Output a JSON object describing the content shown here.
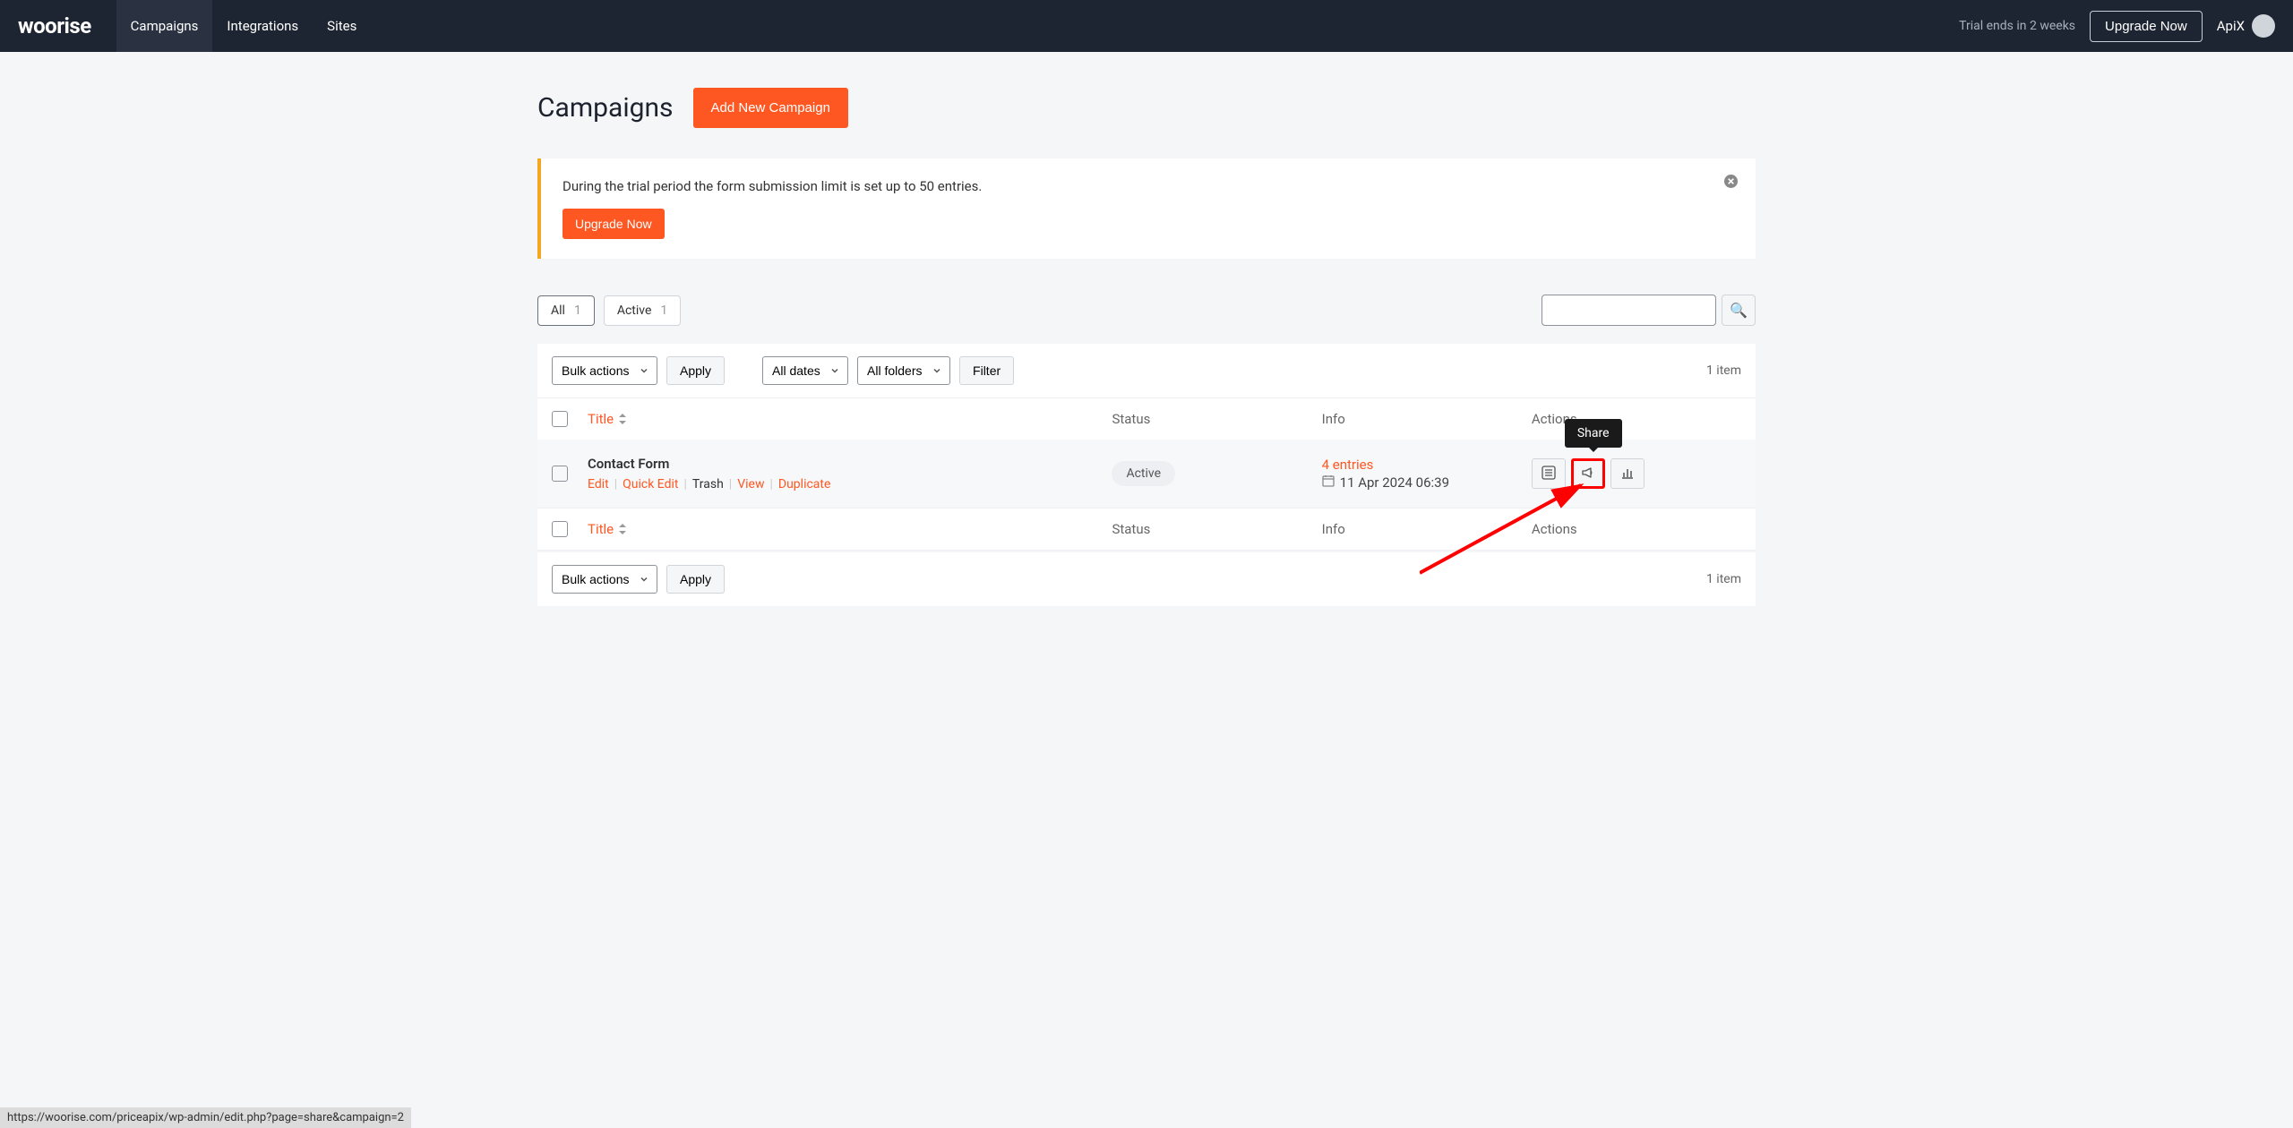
{
  "header": {
    "logo": "woorise",
    "nav": {
      "campaigns": "Campaigns",
      "integrations": "Integrations",
      "sites": "Sites"
    },
    "trial_text": "Trial ends in 2 weeks",
    "upgrade_btn": "Upgrade Now",
    "username": "ApiX"
  },
  "page": {
    "title": "Campaigns",
    "add_btn": "Add New Campaign"
  },
  "notice": {
    "text": "During the trial period the form submission limit is set up to 50 entries.",
    "upgrade_btn": "Upgrade Now"
  },
  "filters": {
    "all_label": "All",
    "all_count": "1",
    "active_label": "Active",
    "active_count": "1"
  },
  "toolbar": {
    "bulk_actions": "Bulk actions",
    "apply": "Apply",
    "all_dates": "All dates",
    "all_folders": "All folders",
    "filter": "Filter",
    "item_count": "1 item"
  },
  "table": {
    "headers": {
      "title": "Title",
      "status": "Status",
      "info": "Info",
      "actions": "Actions"
    },
    "row": {
      "title": "Contact Form",
      "actions": {
        "edit": "Edit",
        "quick_edit": "Quick Edit",
        "trash": "Trash",
        "view": "View",
        "duplicate": "Duplicate"
      },
      "status": "Active",
      "entries": "4 entries",
      "date": "11 Apr 2024 06:39"
    },
    "tooltip": "Share"
  },
  "statusbar": {
    "url": "https://woorise.com/priceapix/wp-admin/edit.php?page=share&campaign=2"
  }
}
